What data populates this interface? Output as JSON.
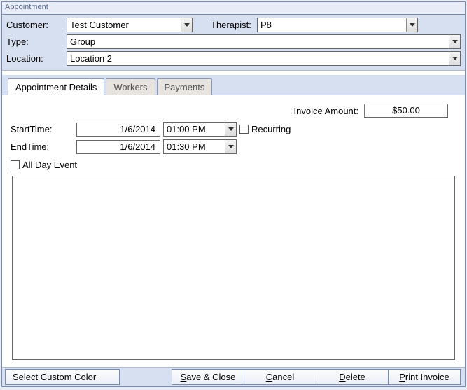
{
  "window": {
    "title": "Appointment"
  },
  "header": {
    "customer_label": "Customer:",
    "customer_value": "Test Customer",
    "therapist_label": "Therapist:",
    "therapist_value": "P8",
    "type_label": "Type:",
    "type_value": "Group",
    "location_label": "Location:",
    "location_value": "Location 2"
  },
  "tabs": {
    "details": "Appointment Details",
    "workers": "Workers",
    "payments": "Payments"
  },
  "details": {
    "invoice_label": "Invoice Amount:",
    "invoice_value": "$50.00",
    "start_label": "StartTime:",
    "start_date": "1/6/2014",
    "start_time": "01:00 PM",
    "end_label": "EndTime:",
    "end_date": "1/6/2014",
    "end_time": "01:30 PM",
    "recurring_label": "Recurring",
    "allday_label": "All Day Event",
    "notes": ""
  },
  "footer": {
    "select_color": "Select Custom Color",
    "save": "ave & Close",
    "save_mn": "S",
    "cancel": "ancel",
    "cancel_mn": "C",
    "delete": "elete",
    "delete_mn": "D",
    "print": "rint Invoice",
    "print_mn": "P"
  }
}
